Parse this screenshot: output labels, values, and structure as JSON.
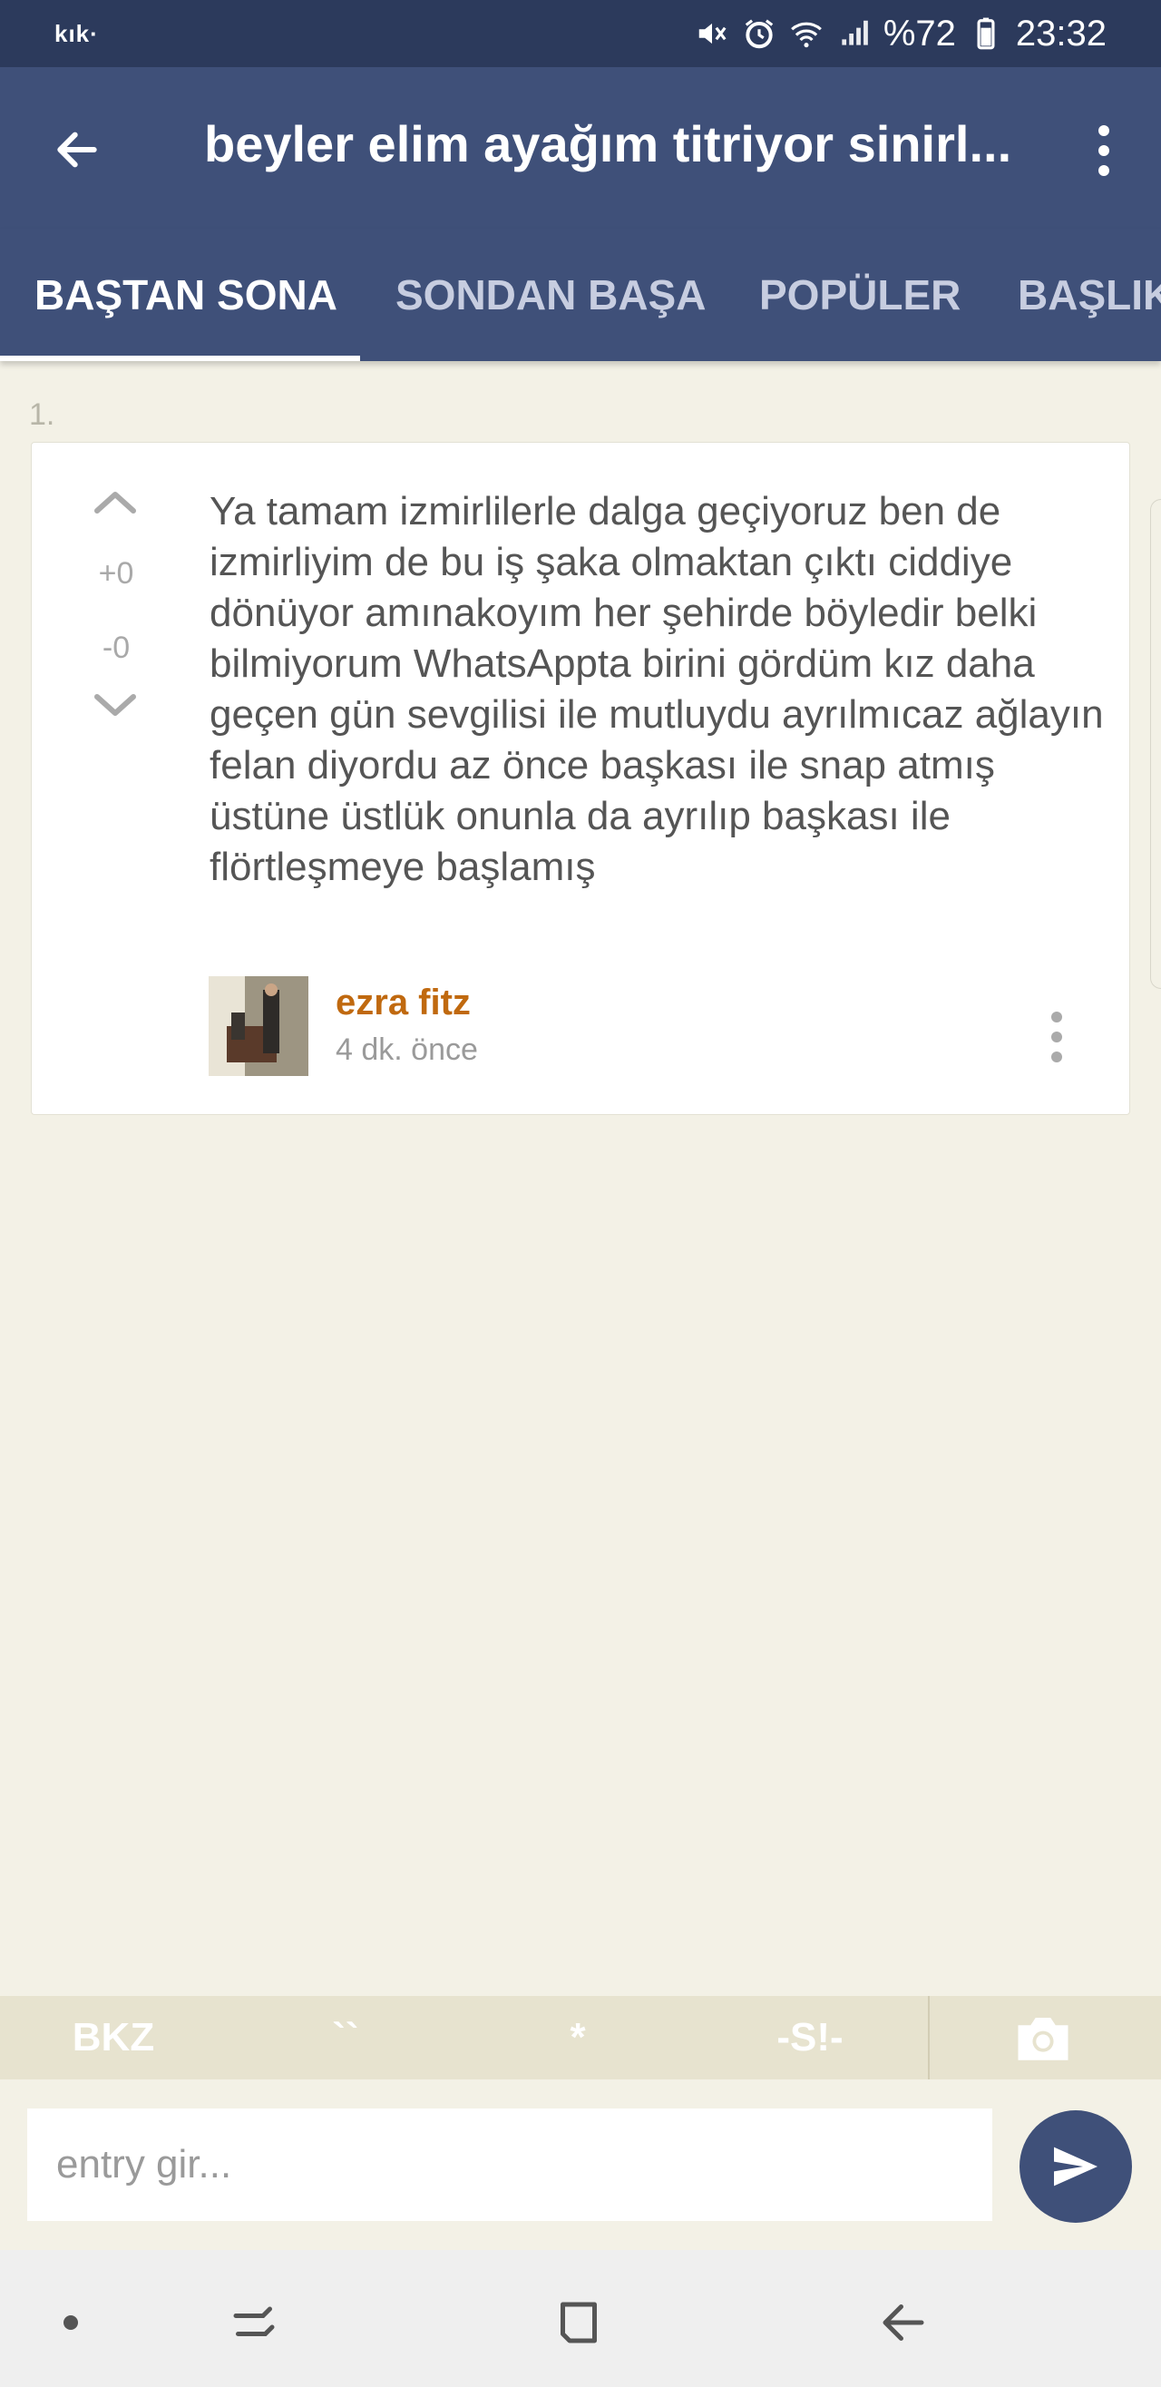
{
  "status_bar": {
    "app_label": "kık·",
    "battery": "%72",
    "time": "23:32",
    "icons": [
      "mute-icon",
      "alarm-icon",
      "wifi-icon",
      "signal-icon",
      "battery-icon"
    ]
  },
  "app_bar": {
    "title": "beyler elim ayağım titriyor sinirl...",
    "back_icon": "arrow-left-icon",
    "more_icon": "more-vertical-icon"
  },
  "tabs": [
    {
      "label": "BAŞTAN SONA",
      "active": true
    },
    {
      "label": "SONDAN BAŞA",
      "active": false
    },
    {
      "label": "POPÜLER",
      "active": false
    },
    {
      "label": "BAŞLIK",
      "active": false
    }
  ],
  "entry": {
    "index": "1.",
    "vote_plus": "+0",
    "vote_minus": "-0",
    "text": "Ya tamam izmirlilerle dalga geçiyoruz ben de izmirliyim de bu iş şaka olmaktan çıktı ciddiye dönüyor amınakoyım her şehirde böyledir belki bilmiyorum WhatsAppta birini gördüm kız daha geçen gün sevgilisi ile mutluydu ayrılmıcaz ağlayın felan diyordu az önce başkası ile snap atmış üstüne üstlük onunla da ayrılıp başkası ile flörtleşmeye başlamış",
    "author": "ezra fitz",
    "time": "4 dk. önce"
  },
  "format_bar": {
    "bkz": "BKZ",
    "backtick": "``",
    "star": "*",
    "spoiler": "-S!-"
  },
  "input": {
    "placeholder": "entry gir...",
    "value": ""
  },
  "colors": {
    "status_bar": "#2c3a5c",
    "header": "#3f5079",
    "background": "#f3f1e6",
    "author": "#c0690f",
    "format_bar": "#e7e3cf"
  }
}
